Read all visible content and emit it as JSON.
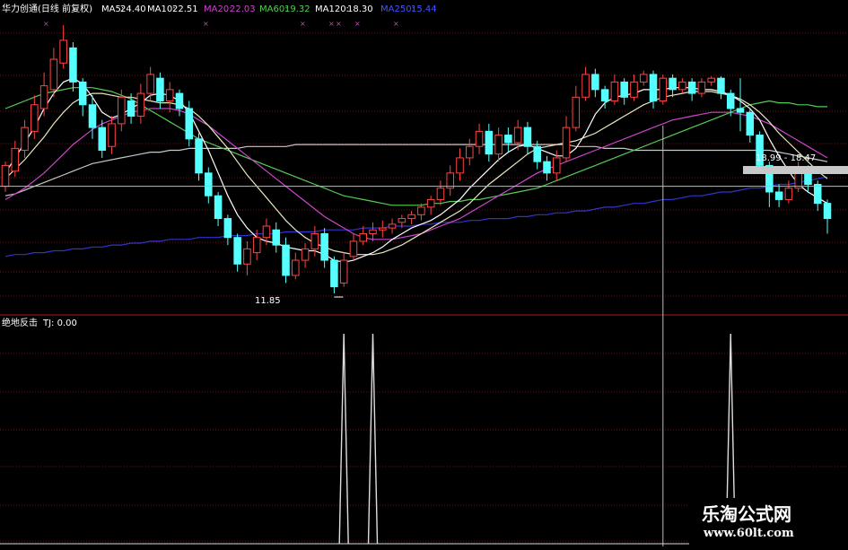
{
  "header": {
    "title": "华力创通(日线 前复权)",
    "ma": [
      {
        "label": "MA5:",
        "value": "24.40",
        "color": "#ffffff"
      },
      {
        "label": "MA10:",
        "value": "22.51",
        "color": "#ffffff"
      },
      {
        "label": "MA20:",
        "value": "22.03",
        "color": "#cc44cc"
      },
      {
        "label": "MA60:",
        "value": "19.32",
        "color": "#55cc55"
      },
      {
        "label": "MA120:",
        "value": "18.30",
        "color": "#ffffff"
      },
      {
        "label": "MA250:",
        "value": "15.44",
        "color": "#4455ff"
      }
    ]
  },
  "price_labels": {
    "low": "11.85",
    "crosshair": "18.99 - 18.47"
  },
  "indicator": {
    "name": "绝地反击",
    "value": "TJ: 0.00"
  },
  "watermark": {
    "title": "乐淘公式网",
    "url": "www.60lt.com"
  },
  "chart_data": {
    "type": "candlestick",
    "title": "华力创通(日线 前复权)",
    "colors": {
      "up": "#ff4444",
      "down": "#55ffff",
      "grid": "#7a1010",
      "ma5": "#ffffff",
      "ma10": "#e8e8c0",
      "ma20": "#cc44cc",
      "ma60": "#55cc55",
      "ma120": "#c8c8c8",
      "ma250": "#3333cc",
      "tj": "#dddddd"
    },
    "price_range": [
      11.0,
      26.0
    ],
    "candles": [
      [
        17.5,
        18.6,
        17.2,
        18.8
      ],
      [
        18.3,
        19.5,
        18.0,
        19.9
      ],
      [
        19.4,
        20.6,
        19.0,
        21.0
      ],
      [
        20.4,
        21.8,
        20.0,
        22.3
      ],
      [
        21.6,
        22.8,
        21.2,
        23.5
      ],
      [
        22.6,
        24.2,
        22.2,
        24.8
      ],
      [
        24.0,
        25.2,
        23.7,
        26.0
      ],
      [
        24.8,
        23.0,
        22.5,
        25.1
      ],
      [
        23.0,
        21.8,
        21.2,
        23.2
      ],
      [
        21.8,
        20.6,
        20.0,
        22.3
      ],
      [
        20.6,
        19.4,
        19.0,
        21.0
      ],
      [
        19.6,
        20.8,
        19.2,
        21.2
      ],
      [
        20.8,
        22.2,
        20.4,
        22.6
      ],
      [
        22.0,
        21.2,
        20.8,
        22.4
      ],
      [
        21.2,
        22.4,
        20.8,
        22.9
      ],
      [
        22.4,
        23.4,
        22.0,
        23.8
      ],
      [
        23.2,
        22.0,
        21.6,
        23.5
      ],
      [
        22.0,
        22.6,
        21.4,
        23.0
      ],
      [
        22.4,
        21.6,
        21.2,
        22.6
      ],
      [
        21.6,
        20.0,
        19.6,
        22.0
      ],
      [
        20.0,
        18.2,
        17.8,
        20.3
      ],
      [
        18.2,
        17.0,
        16.6,
        18.5
      ],
      [
        17.0,
        15.8,
        15.4,
        17.2
      ],
      [
        15.8,
        14.8,
        14.4,
        16.0
      ],
      [
        14.8,
        13.4,
        13.0,
        15.0
      ],
      [
        13.4,
        14.2,
        12.8,
        14.6
      ],
      [
        14.0,
        14.8,
        13.6,
        15.2
      ],
      [
        14.8,
        15.4,
        14.4,
        15.8
      ],
      [
        15.2,
        14.4,
        14.0,
        15.6
      ],
      [
        14.4,
        12.8,
        12.4,
        14.8
      ],
      [
        12.8,
        13.6,
        12.6,
        14.0
      ],
      [
        13.6,
        14.2,
        13.2,
        14.5
      ],
      [
        14.2,
        15.0,
        13.8,
        15.4
      ],
      [
        15.0,
        13.6,
        13.2,
        15.3
      ],
      [
        13.6,
        12.2,
        11.85,
        13.8
      ],
      [
        12.4,
        13.6,
        12.2,
        14.0
      ],
      [
        13.8,
        14.6,
        13.6,
        15.0
      ],
      [
        14.6,
        15.0,
        14.4,
        15.4
      ],
      [
        15.0,
        15.2,
        14.6,
        15.6
      ],
      [
        15.2,
        15.3,
        14.8,
        15.7
      ],
      [
        15.3,
        15.5,
        15.0,
        15.8
      ],
      [
        15.6,
        15.8,
        15.3,
        16.0
      ],
      [
        15.8,
        16.0,
        15.5,
        16.2
      ],
      [
        16.0,
        16.4,
        15.7,
        16.6
      ],
      [
        16.4,
        16.8,
        16.0,
        17.0
      ],
      [
        16.8,
        17.4,
        16.5,
        17.8
      ],
      [
        17.4,
        18.2,
        17.0,
        18.6
      ],
      [
        18.2,
        19.0,
        17.8,
        19.5
      ],
      [
        19.0,
        19.6,
        18.6,
        20.0
      ],
      [
        19.6,
        20.4,
        19.2,
        20.8
      ],
      [
        20.4,
        19.2,
        18.8,
        20.8
      ],
      [
        19.2,
        20.2,
        18.8,
        20.6
      ],
      [
        20.2,
        19.8,
        19.3,
        20.6
      ],
      [
        19.8,
        20.6,
        19.4,
        21.0
      ],
      [
        20.6,
        19.6,
        19.2,
        20.9
      ],
      [
        19.6,
        18.8,
        18.4,
        19.9
      ],
      [
        18.8,
        18.2,
        17.8,
        19.1
      ],
      [
        18.2,
        19.0,
        17.8,
        19.4
      ],
      [
        19.0,
        20.6,
        18.8,
        21.2
      ],
      [
        20.6,
        22.2,
        20.4,
        22.8
      ],
      [
        22.2,
        23.4,
        22.0,
        23.8
      ],
      [
        23.4,
        22.6,
        22.2,
        23.7
      ],
      [
        22.6,
        22.0,
        21.6,
        22.8
      ],
      [
        22.0,
        23.0,
        21.8,
        23.4
      ],
      [
        23.0,
        22.2,
        21.8,
        23.2
      ],
      [
        22.2,
        23.0,
        22.0,
        23.4
      ],
      [
        23.0,
        23.4,
        22.8,
        23.6
      ],
      [
        23.4,
        22.0,
        21.6,
        23.6
      ],
      [
        22.0,
        23.2,
        21.8,
        23.4
      ],
      [
        23.2,
        22.6,
        22.2,
        23.4
      ],
      [
        22.6,
        23.0,
        22.4,
        23.2
      ],
      [
        23.0,
        22.4,
        22.0,
        23.2
      ],
      [
        22.4,
        23.0,
        22.2,
        23.2
      ],
      [
        23.0,
        23.2,
        22.8,
        23.3
      ],
      [
        23.2,
        22.4,
        22.1,
        23.3
      ],
      [
        22.4,
        21.6,
        21.2,
        22.6
      ],
      [
        21.6,
        21.4,
        20.4,
        23.2
      ],
      [
        21.4,
        20.2,
        19.8,
        21.6
      ],
      [
        20.2,
        18.6,
        18.2,
        20.4
      ],
      [
        18.6,
        17.2,
        16.4,
        18.8
      ],
      [
        17.2,
        16.8,
        16.4,
        17.6
      ],
      [
        16.8,
        17.4,
        16.6,
        17.8
      ],
      [
        17.4,
        18.4,
        17.2,
        18.8
      ],
      [
        18.4,
        17.6,
        17.2,
        18.6
      ],
      [
        17.6,
        16.6,
        16.2,
        17.8
      ],
      [
        16.6,
        15.8,
        15.0,
        16.8
      ]
    ],
    "ma5": [
      18.2,
      19.0,
      19.8,
      20.6,
      21.6,
      22.4,
      23.0,
      23.2,
      22.9,
      22.2,
      21.4,
      21.1,
      21.3,
      21.6,
      21.9,
      22.3,
      22.4,
      22.3,
      22.0,
      21.4,
      20.4,
      19.4,
      18.2,
      17.0,
      16.0,
      15.3,
      14.8,
      14.6,
      14.5,
      14.3,
      14.2,
      14.1,
      14.1,
      13.9,
      13.6,
      13.5,
      13.6,
      13.8,
      14.0,
      14.3,
      14.7,
      15.0,
      15.3,
      15.5,
      15.7,
      16.0,
      16.4,
      16.8,
      17.4,
      17.9,
      18.4,
      18.9,
      19.3,
      19.6,
      19.7,
      19.5,
      19.3,
      19.1,
      19.1,
      19.5,
      20.3,
      21.3,
      21.9,
      22.2,
      22.3,
      22.4,
      22.6,
      22.6,
      22.6,
      22.7,
      22.7,
      22.7,
      22.6,
      22.6,
      22.5,
      22.3,
      22.0,
      21.6,
      21.0,
      20.0,
      19.1,
      18.3,
      17.6,
      17.2,
      16.9,
      16.6
    ],
    "ma10": [
      17.9,
      18.4,
      18.9,
      19.5,
      20.1,
      20.8,
      21.4,
      21.9,
      22.2,
      22.4,
      22.4,
      22.3,
      22.2,
      22.2,
      22.1,
      22.0,
      21.9,
      21.9,
      21.8,
      21.6,
      21.2,
      20.7,
      20.1,
      19.5,
      18.8,
      18.1,
      17.5,
      16.9,
      16.3,
      15.7,
      15.2,
      14.8,
      14.5,
      14.3,
      14.1,
      14.0,
      13.9,
      13.9,
      13.9,
      14.0,
      14.2,
      14.4,
      14.7,
      15.0,
      15.3,
      15.6,
      15.9,
      16.2,
      16.6,
      17.1,
      17.6,
      18.0,
      18.4,
      18.8,
      19.2,
      19.5,
      19.6,
      19.7,
      19.8,
      19.9,
      20.1,
      20.3,
      20.6,
      20.9,
      21.2,
      21.5,
      21.8,
      22.0,
      22.2,
      22.3,
      22.4,
      22.5,
      22.5,
      22.5,
      22.4,
      22.3,
      22.1,
      21.8,
      21.4,
      20.9,
      20.3,
      19.8,
      19.3,
      18.8,
      18.3,
      17.9
    ],
    "ma20": [
      16.8,
      17.1,
      17.4,
      17.8,
      18.2,
      18.7,
      19.2,
      19.7,
      20.1,
      20.5,
      20.8,
      21.0,
      21.2,
      21.4,
      21.5,
      21.6,
      21.6,
      21.6,
      21.5,
      21.3,
      21.0,
      20.7,
      20.3,
      19.9,
      19.5,
      19.1,
      18.7,
      18.3,
      17.9,
      17.5,
      17.1,
      16.7,
      16.3,
      15.9,
      15.6,
      15.3,
      15.0,
      14.8,
      14.7,
      14.7,
      14.7,
      14.8,
      14.9,
      15.0,
      15.2,
      15.4,
      15.6,
      15.8,
      16.1,
      16.4,
      16.7,
      17.0,
      17.3,
      17.6,
      17.9,
      18.2,
      18.4,
      18.6,
      18.8,
      19.0,
      19.2,
      19.4,
      19.6,
      19.8,
      20.0,
      20.2,
      20.4,
      20.6,
      20.8,
      21.0,
      21.1,
      21.2,
      21.3,
      21.4,
      21.4,
      21.4,
      21.3,
      21.2,
      21.0,
      20.8,
      20.5,
      20.2,
      19.9,
      19.6,
      19.3,
      19.0
    ],
    "ma60": [
      21.6,
      21.8,
      22.0,
      22.2,
      22.4,
      22.5,
      22.6,
      22.7,
      22.7,
      22.7,
      22.6,
      22.5,
      22.3,
      22.1,
      21.8,
      21.5,
      21.2,
      20.9,
      20.6,
      20.3,
      20.0,
      19.8,
      19.6,
      19.4,
      19.2,
      19.0,
      18.8,
      18.6,
      18.4,
      18.2,
      18.0,
      17.8,
      17.6,
      17.4,
      17.2,
      17.0,
      16.9,
      16.8,
      16.7,
      16.6,
      16.5,
      16.5,
      16.5,
      16.5,
      16.6,
      16.6,
      16.7,
      16.7,
      16.8,
      16.8,
      16.9,
      17.0,
      17.1,
      17.2,
      17.3,
      17.4,
      17.6,
      17.8,
      18.0,
      18.2,
      18.4,
      18.6,
      18.8,
      19.0,
      19.2,
      19.4,
      19.6,
      19.8,
      20.0,
      20.2,
      20.4,
      20.6,
      20.8,
      21.0,
      21.2,
      21.4,
      21.6,
      21.8,
      21.9,
      22.0,
      21.9,
      21.9,
      21.8,
      21.8,
      21.7,
      21.7
    ],
    "ma120": [
      17.0,
      17.1,
      17.3,
      17.5,
      17.7,
      17.9,
      18.1,
      18.3,
      18.5,
      18.7,
      18.8,
      18.9,
      19.0,
      19.1,
      19.2,
      19.3,
      19.3,
      19.4,
      19.4,
      19.5,
      19.5,
      19.5,
      19.5,
      19.5,
      19.5,
      19.6,
      19.6,
      19.6,
      19.6,
      19.6,
      19.7,
      19.7,
      19.7,
      19.7,
      19.7,
      19.7,
      19.7,
      19.7,
      19.7,
      19.7,
      19.7,
      19.7,
      19.7,
      19.7,
      19.7,
      19.7,
      19.7,
      19.7,
      19.7,
      19.7,
      19.7,
      19.7,
      19.7,
      19.7,
      19.7,
      19.7,
      19.7,
      19.7,
      19.7,
      19.6,
      19.6,
      19.6,
      19.5,
      19.5,
      19.5,
      19.4,
      19.4,
      19.4,
      19.4,
      19.4,
      19.4,
      19.4,
      19.4,
      19.4,
      19.4,
      19.4,
      19.4,
      19.4,
      19.4,
      19.4,
      19.3,
      19.2,
      19.1,
      19.0,
      18.9,
      18.8
    ],
    "ma250": [
      13.8,
      13.9,
      13.9,
      14.0,
      14.0,
      14.1,
      14.1,
      14.2,
      14.2,
      14.3,
      14.3,
      14.4,
      14.4,
      14.5,
      14.5,
      14.6,
      14.6,
      14.7,
      14.7,
      14.7,
      14.8,
      14.8,
      14.8,
      14.9,
      14.9,
      14.9,
      15.0,
      15.0,
      15.0,
      15.1,
      15.1,
      15.1,
      15.1,
      15.2,
      15.2,
      15.2,
      15.2,
      15.3,
      15.3,
      15.3,
      15.4,
      15.4,
      15.4,
      15.5,
      15.5,
      15.6,
      15.6,
      15.6,
      15.7,
      15.7,
      15.8,
      15.8,
      15.8,
      15.9,
      15.9,
      16.0,
      16.0,
      16.1,
      16.1,
      16.2,
      16.2,
      16.3,
      16.4,
      16.4,
      16.5,
      16.6,
      16.6,
      16.7,
      16.8,
      16.8,
      16.9,
      17.0,
      17.0,
      17.1,
      17.2,
      17.2,
      17.3,
      17.4,
      17.4,
      17.5,
      17.6,
      17.6,
      17.7,
      17.8,
      17.9,
      18.0
    ],
    "crosshair_index": 68,
    "crosshair_price": 17.5,
    "tj_signals": [
      {
        "index": 35,
        "value": 1
      },
      {
        "index": 38,
        "value": 1
      },
      {
        "index": 75,
        "value": 1
      }
    ]
  }
}
